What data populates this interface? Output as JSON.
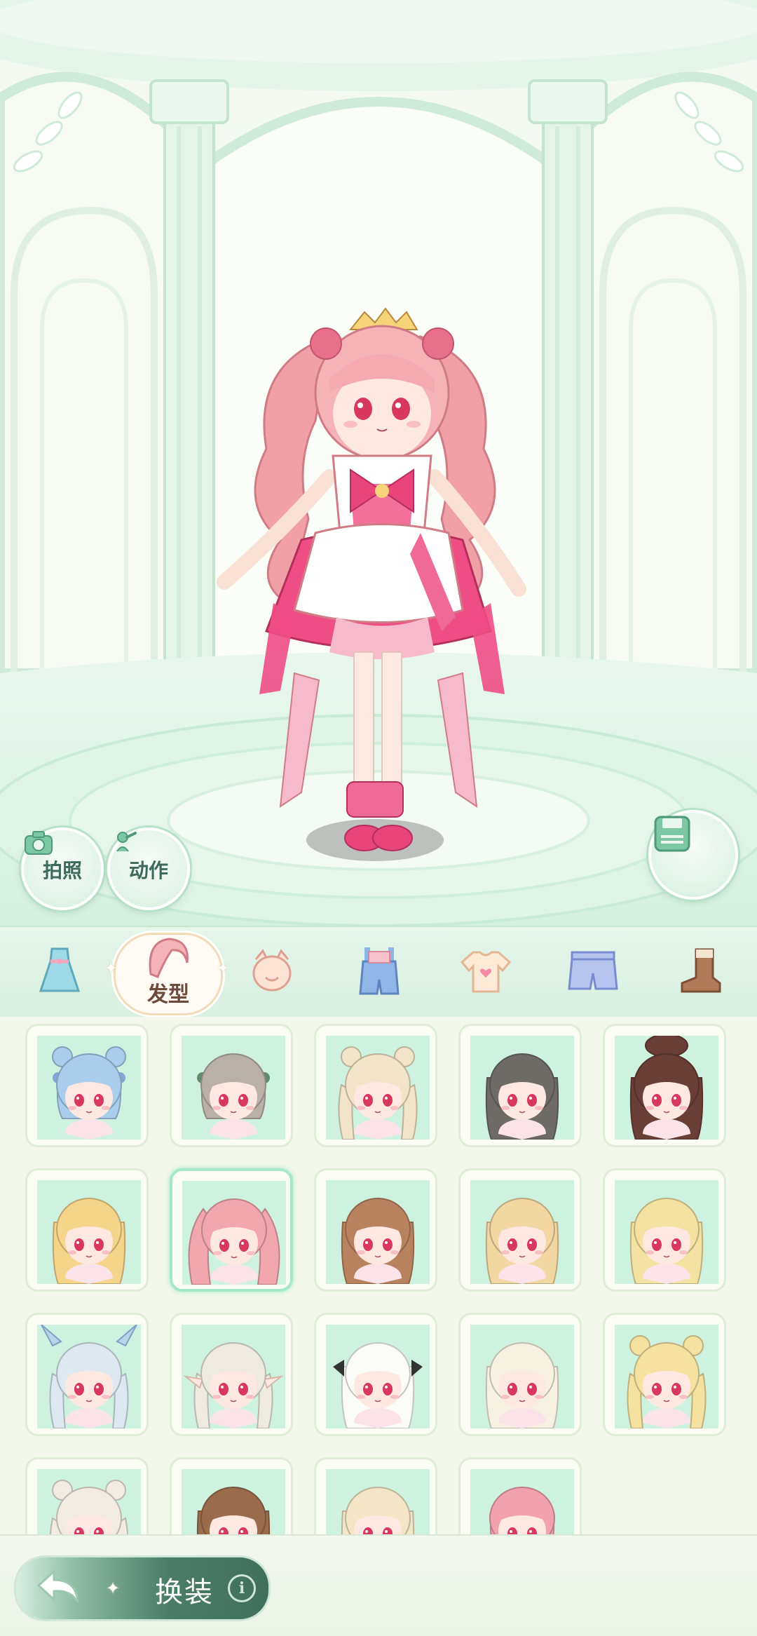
{
  "stage": {
    "photo_label": "拍照",
    "pose_label": "动作"
  },
  "categories": [
    {
      "name": "dress-set",
      "icon": "dress-icon"
    },
    {
      "name": "hairstyle",
      "icon": "hair-icon",
      "label": "发型",
      "selected": true
    },
    {
      "name": "face",
      "icon": "face-icon"
    },
    {
      "name": "overalls",
      "icon": "overalls-icon"
    },
    {
      "name": "top",
      "icon": "tshirt-icon"
    },
    {
      "name": "shorts",
      "icon": "shorts-icon"
    },
    {
      "name": "shoes",
      "icon": "boot-icon"
    }
  ],
  "hairstyles": [
    {
      "color": "#a9cdec",
      "style": "short-buns",
      "bow": "#7fa8d8"
    },
    {
      "color": "#b9b1a8",
      "style": "bob-clip",
      "bow": "#5f8a6b"
    },
    {
      "color": "#f1e4c8",
      "style": "double-buns-braids"
    },
    {
      "color": "#6e6a66",
      "style": "long-straight"
    },
    {
      "color": "#6a3e36",
      "style": "updo-long"
    },
    {
      "color": "#f6d48a",
      "style": "long-straight"
    },
    {
      "color": "#f2a6ae",
      "style": "twin-tails",
      "selected": true
    },
    {
      "color": "#b9825e",
      "style": "side-wave"
    },
    {
      "color": "#f2d7a2",
      "style": "long-wavy"
    },
    {
      "color": "#f4e2a2",
      "style": "long-wavy"
    },
    {
      "color": "#dde8f0",
      "style": "wing-braids"
    },
    {
      "color": "#eeeae0",
      "style": "elf-braids"
    },
    {
      "color": "#fbfbf8",
      "style": "bow-long"
    },
    {
      "color": "#f7f1e2",
      "style": "long-wavy"
    },
    {
      "color": "#f6e2a0",
      "style": "double-buns-braids"
    },
    {
      "color": "#f2ebe2",
      "style": "star-buns"
    },
    {
      "color": "#9a6c4c",
      "style": "side-wave"
    },
    {
      "color": "#f3e6c6",
      "style": "long-straight"
    },
    {
      "color": "#f2a2ae",
      "style": "bob-clip"
    }
  ],
  "bottom": {
    "outfit_label": "换装",
    "info_symbol": "i"
  },
  "colors": {
    "accent_green": "#a5e8c8",
    "card_bg": "#cdf2e0",
    "dark_green_button": "#3f705c"
  }
}
